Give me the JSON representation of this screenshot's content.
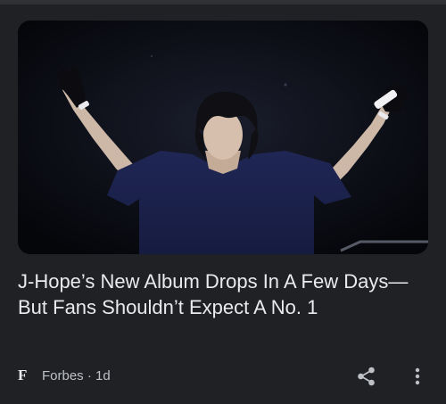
{
  "article": {
    "image": {
      "description_icon": "concert-performer-photo"
    },
    "headline": "J-Hope’s New Album Drops In A Few Days—But Fans Shouldn’t Expect A No. 1",
    "publisher": {
      "logo_letter": "F",
      "name": "Forbes",
      "separator": "·",
      "age": "1d"
    },
    "actions": {
      "share_icon": "share-icon",
      "more_icon": "more-vert-icon"
    }
  },
  "colors": {
    "background": "#202124",
    "text_primary": "#e8eaed",
    "text_secondary": "#bdc1c6"
  }
}
